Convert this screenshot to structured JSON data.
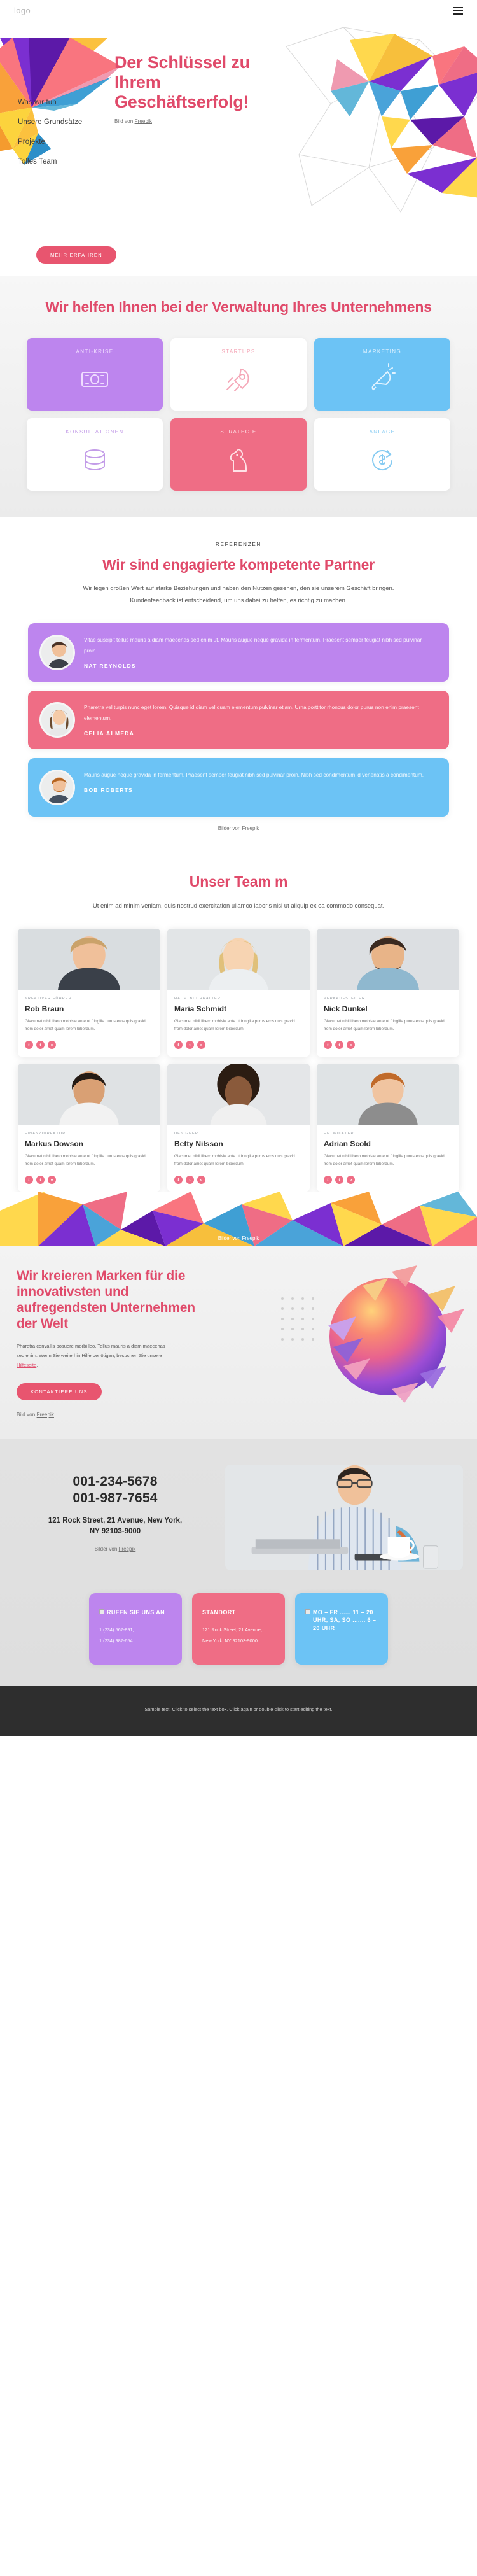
{
  "header": {
    "logo": "logo",
    "menu_icon": "hamburger-icon"
  },
  "hero": {
    "nav": [
      {
        "label": "Was wir tun"
      },
      {
        "label": "Unsere Grundsätze"
      },
      {
        "label": "Projekte"
      },
      {
        "label": "Tolles Team"
      }
    ],
    "title_line1": "Der Schlüssel zu",
    "title_line2": "Ihrem",
    "title_line3": "Geschäftserfolg!",
    "credit_prefix": "Bild von ",
    "credit_link": "Freepik",
    "cta": "MEHR ERFAHREN"
  },
  "services": {
    "title": "Wir helfen Ihnen bei der Verwaltung Ihres Unternehmens",
    "cards": [
      {
        "label": "ANTI-KRISE",
        "theme": "purple",
        "icon": "banknote-icon"
      },
      {
        "label": "STARTUPS",
        "theme": "white-r",
        "icon": "rocket-icon"
      },
      {
        "label": "MARKETING",
        "theme": "blue",
        "icon": "megaphone-icon"
      },
      {
        "label": "KONSULTATIONEN",
        "theme": "white-p",
        "icon": "coins-icon"
      },
      {
        "label": "STRATEGIE",
        "theme": "red",
        "icon": "chess-knight-icon"
      },
      {
        "label": "ANLAGE",
        "theme": "white-b",
        "icon": "money-cycle-icon"
      }
    ]
  },
  "testimonials": {
    "eyebrow": "REFERENZEN",
    "title": "Wir sind engagierte kompetente Partner",
    "subtitle": "Wir legen großen Wert auf starke Beziehungen und haben den Nutzen gesehen, den sie unserem Geschäft bringen. Kundenfeedback ist entscheidend, um uns dabei zu helfen, es richtig zu machen.",
    "items": [
      {
        "text": "Vitae suscipit tellus mauris a diam maecenas sed enim ut. Mauris augue neque gravida in fermentum. Praesent semper feugiat nibh sed pulvinar proin.",
        "name": "NAT REYNOLDS",
        "theme": "c1"
      },
      {
        "text": "Pharetra vel turpis nunc eget lorem. Quisque id diam vel quam elementum pulvinar etiam. Urna porttitor rhoncus dolor purus non enim praesent elementum.",
        "name": "CELIA ALMEDA",
        "theme": "c2"
      },
      {
        "text": "Mauris augue neque gravida in fermentum. Praesent semper feugiat nibh sed pulvinar proin. Nibh sed condimentum id venenatis a condimentum.",
        "name": "BOB ROBERTS",
        "theme": "c3"
      }
    ],
    "credit_prefix": "Bilder von ",
    "credit_link": "Freepik"
  },
  "team": {
    "title": "Unser Team m",
    "subtitle": "Ut enim ad minim veniam, quis nostrud exercitation ullamco laboris nisi ut aliquip ex ea commodo consequat.",
    "desc": "Giacumet nihil libero mobisie ante ut fringilla purus eros quis gravid from dolor amet quam lorem biberdum.",
    "members": [
      {
        "role": "KREATIVER FÜHRER",
        "name": "Rob Braun"
      },
      {
        "role": "HAUPTBUCHHALTER",
        "name": "Maria Schmidt"
      },
      {
        "role": "VERKAUFSLEITER",
        "name": "Nick Dunkel"
      },
      {
        "role": "FINANZDIREKTOR",
        "name": "Markus Dowson"
      },
      {
        "role": "DESIGNER",
        "name": "Betty Nilsson"
      },
      {
        "role": "ENTWICKLER",
        "name": "Adrian Scold"
      }
    ],
    "socials": [
      "f",
      "t",
      "o"
    ],
    "credit_prefix": "Bilder von ",
    "credit_link": "Freepik"
  },
  "brands": {
    "title": "Wir kreieren Marken für die innovativsten und aufregendsten Unternehmen der Welt",
    "text_a": "Pharetra convallis posuere morbi leo. Tellus mauris a diam maecenas sed enim. Wenn Sie weiterhin Hilfe benötigen, besuchen Sie unsere ",
    "text_link": "Hilfeseite",
    "text_b": ".",
    "cta": "KONTAKTIERE UNS",
    "credit_prefix": "Bild von ",
    "credit_link": "Freepik"
  },
  "contact": {
    "phone1": "001-234-5678",
    "phone2": "001-987-7654",
    "address_line1": "121 Rock Street, 21 Avenue, New York,",
    "address_line2": "NY 92103-9000",
    "credit_prefix": "Bilder von ",
    "credit_link": "Freepik",
    "cards": [
      {
        "theme": "purple",
        "has_broken_image": true,
        "title": "RUFEN SIE UNS AN",
        "lines": [
          "1 (234) 567-891,",
          "1 (234) 987-654"
        ]
      },
      {
        "theme": "red",
        "has_broken_image": false,
        "title": "STANDORT",
        "lines": [
          "121 Rock Street, 21 Avenue,",
          "New York, NY 92103-9000"
        ]
      },
      {
        "theme": "blue",
        "has_broken_image": true,
        "title": "MO – FR ...... 11 – 20 UHR, SA, SO ....... 6 – 20 UHR",
        "lines": []
      }
    ]
  },
  "footer": {
    "text": "Sample text. Click to select the text box. Click again or double click to start editing the text."
  },
  "colors": {
    "accent_pink": "#e04a6a",
    "btn_pink": "#e8556f",
    "purple": "#bd85ee",
    "blue": "#6cc3f5",
    "red": "#ef6d85",
    "dark": "#2e2e2e"
  }
}
